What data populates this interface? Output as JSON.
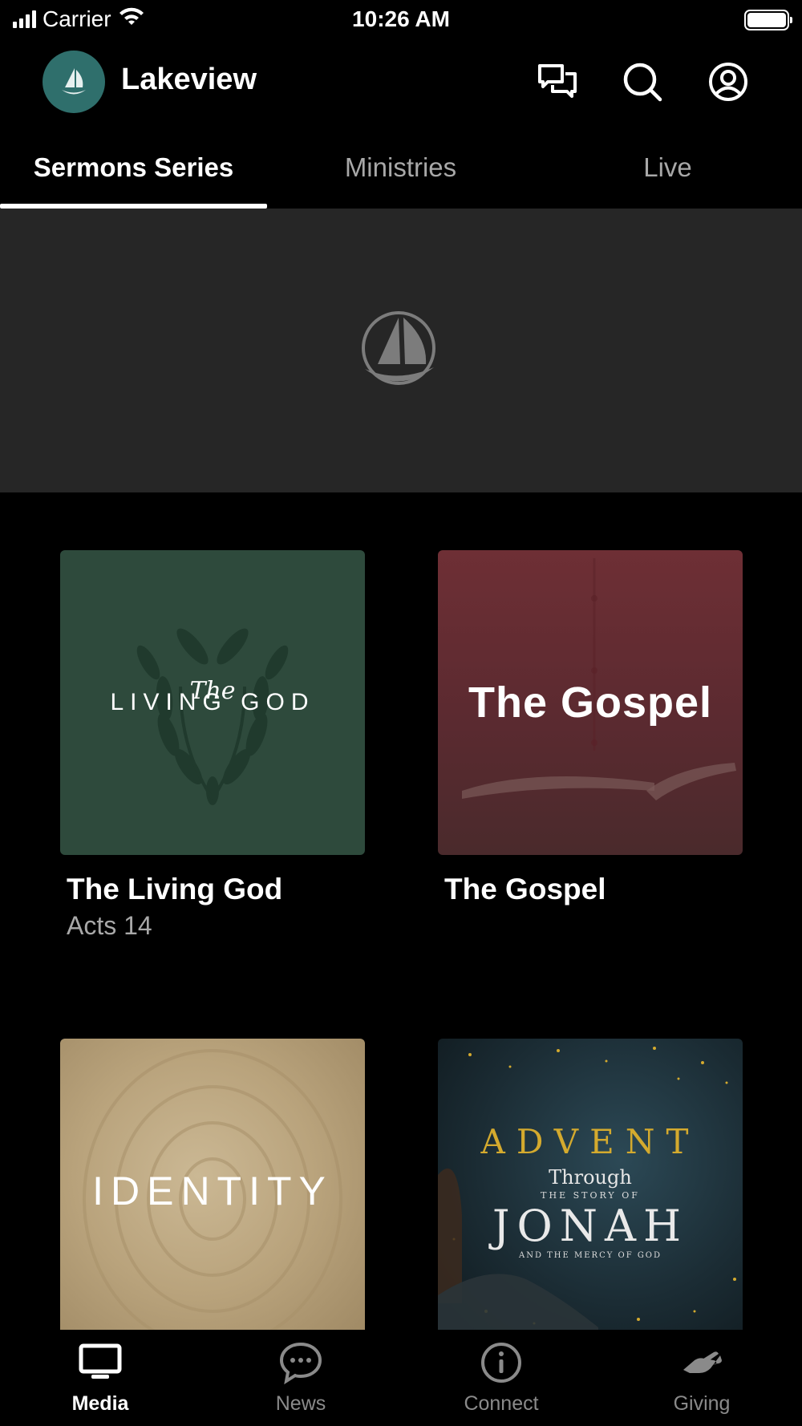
{
  "status_bar": {
    "carrier": "Carrier",
    "time": "10:26 AM"
  },
  "header": {
    "app_title": "Lakeview",
    "icons": [
      "chat-icon",
      "search-icon",
      "account-icon"
    ]
  },
  "tabs": [
    {
      "label": "Sermons Series",
      "active": true
    },
    {
      "label": "Ministries",
      "active": false
    },
    {
      "label": "Live",
      "active": false
    }
  ],
  "hero": {
    "icon": "sailboat-logo-icon"
  },
  "series": [
    {
      "title": "The Living God",
      "subtitle": "Acts 14",
      "art_script": "The",
      "art_text": "LIVING GOD",
      "color": "#2e4a3c"
    },
    {
      "title": "The Gospel",
      "subtitle": "",
      "art_text": "The Gospel",
      "color": "#6e2f35"
    },
    {
      "title": "",
      "subtitle": "",
      "art_text": "IDENTITY",
      "color": "#b9a37c"
    },
    {
      "title": "",
      "subtitle": "",
      "art_line1": "ADVENT",
      "art_line2": "Through",
      "art_line3": "THE STORY OF",
      "art_line4": "JONAH",
      "art_line5": "AND THE MERCY OF GOD",
      "color": "#1b2c34",
      "accent": "#d4aa2e"
    }
  ],
  "tabbar": [
    {
      "label": "Media",
      "icon": "tv-icon",
      "active": true
    },
    {
      "label": "News",
      "icon": "chat-bubble-icon",
      "active": false
    },
    {
      "label": "Connect",
      "icon": "info-icon",
      "active": false
    },
    {
      "label": "Giving",
      "icon": "giving-hand-icon",
      "active": false
    }
  ]
}
